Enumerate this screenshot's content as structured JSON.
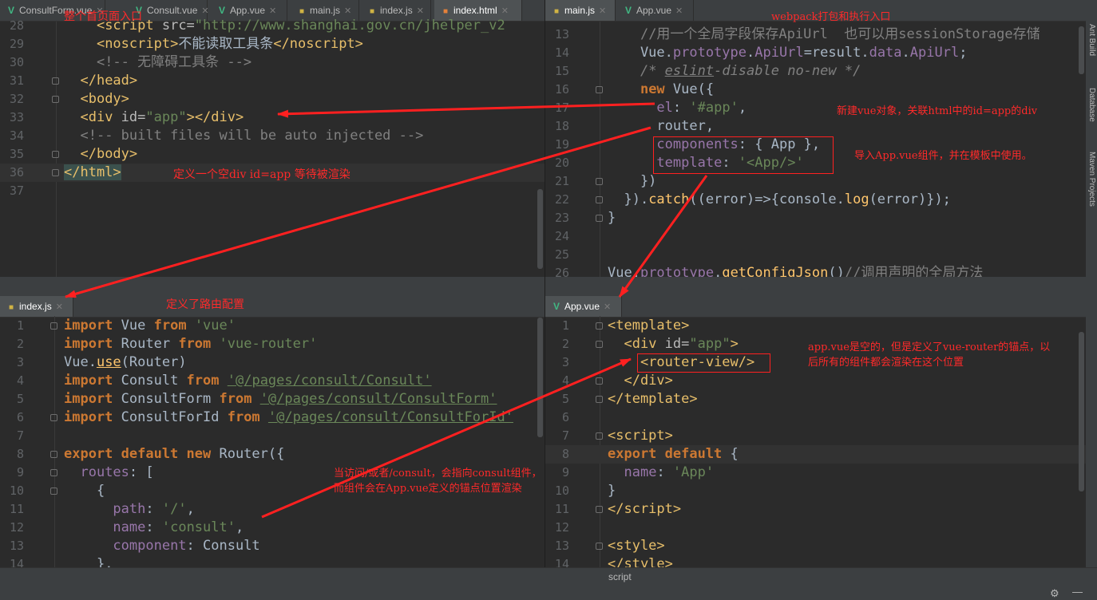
{
  "top_left": {
    "tabs": [
      "ConsultForm.vue",
      "Consult.vue",
      "App.vue",
      "main.js",
      "index.js",
      "index.html"
    ],
    "lines": [
      {
        "n": "28",
        "html": "    <span class=\"t\">&lt;script </span><span class=\"a\">src=</span><span class=\"s\">\"http://www.shanghai.gov.cn/jhelper_v2</span>"
      },
      {
        "n": "29",
        "html": "    <span class=\"t\">&lt;noscript&gt;</span>不能读取工具条<span class=\"t\">&lt;/noscript&gt;</span>"
      },
      {
        "n": "30",
        "html": "    <span class=\"c\">&lt;!-- 无障碍工具条 --&gt;</span>"
      },
      {
        "n": "31",
        "html": "  <span class=\"t\">&lt;/head&gt;</span>"
      },
      {
        "n": "32",
        "html": "  <span class=\"t\">&lt;body&gt;</span>"
      },
      {
        "n": "33",
        "html": "  <span class=\"t\">&lt;div </span><span class=\"a\">id=</span><span class=\"s\">\"app\"</span><span class=\"t\">&gt;&lt;/div&gt;</span>"
      },
      {
        "n": "34",
        "html": "  <span class=\"c\">&lt;!-- built files will be auto injected --&gt;</span>"
      },
      {
        "n": "35",
        "html": "  <span class=\"t\">&lt;/body&gt;</span>"
      },
      {
        "n": "36",
        "html": "<span class=\"t hl\">&lt;/html&gt;</span>"
      },
      {
        "n": "37",
        "html": ""
      }
    ]
  },
  "top_right": {
    "tabs": [
      "main.js",
      "App.vue"
    ],
    "lines": [
      {
        "n": "13",
        "html": "    <span class=\"c\">//用一个全局字段保存ApiUrl  也可以用sessionStorage存储</span>"
      },
      {
        "n": "14",
        "html": "    Vue.<span class=\"p\">prototype</span>.<span class=\"p\">ApiUrl</span>=result.<span class=\"p\">data</span>.<span class=\"p\">ApiUrl</span>;"
      },
      {
        "n": "15",
        "html": "    <span class=\"ci\">/* <span style=\"text-decoration:underline\">eslint</span>-disable no-new */</span>"
      },
      {
        "n": "16",
        "html": "    <span class=\"k\">new</span> Vue({"
      },
      {
        "n": "17",
        "html": "      <span class=\"p\">el</span>: <span class=\"s\">'#app'</span>,"
      },
      {
        "n": "18",
        "html": "      router,"
      },
      {
        "n": "19",
        "html": "      <span class=\"p\">components</span>: { App },"
      },
      {
        "n": "20",
        "html": "      <span class=\"p\">template</span>: <span class=\"s\">'&lt;App/&gt;'</span>"
      },
      {
        "n": "21",
        "html": "    })"
      },
      {
        "n": "22",
        "html": "  }).<span class=\"f\">catch</span>((error)=>{console.<span class=\"f\">log</span>(error)});"
      },
      {
        "n": "23",
        "html": "}"
      },
      {
        "n": "24",
        "html": ""
      },
      {
        "n": "25",
        "html": ""
      },
      {
        "n": "26",
        "html": "Vue.<span class=\"p\">prototype</span>.<span class=\"f\">getConfigJson</span>()<span class=\"c\">//调用声明的全局方法</span>"
      }
    ]
  },
  "bottom_left": {
    "tabs": [
      "index.js"
    ],
    "lines": [
      {
        "n": "1",
        "html": "<span class=\"k\">import</span> Vue <span class=\"k\">from</span> <span class=\"s\">'vue'</span>"
      },
      {
        "n": "2",
        "html": "<span class=\"k\">import</span> Router <span class=\"k\">from</span> <span class=\"s\">'vue-router'</span>"
      },
      {
        "n": "3",
        "html": "Vue.<span class=\"f\" style=\"text-decoration:underline\">use</span>(Router)"
      },
      {
        "n": "4",
        "html": "<span class=\"k\">import</span> Consult <span class=\"k\">from</span> <span class=\"s u\">'@/pages/consult/Consult'</span>"
      },
      {
        "n": "5",
        "html": "<span class=\"k\">import</span> ConsultForm <span class=\"k\">from</span> <span class=\"s u\">'@/pages/consult/ConsultForm'</span>"
      },
      {
        "n": "6",
        "html": "<span class=\"k\">import</span> ConsultForId <span class=\"k\">from</span> <span class=\"s u\">'@/pages/consult/ConsultForId'</span>"
      },
      {
        "n": "7",
        "html": ""
      },
      {
        "n": "8",
        "html": "<span class=\"k\">export default new</span> Router({"
      },
      {
        "n": "9",
        "html": "  <span class=\"p\">routes</span>: ["
      },
      {
        "n": "10",
        "html": "    {"
      },
      {
        "n": "11",
        "html": "      <span class=\"p\">path</span>: <span class=\"s\">'/'</span>,"
      },
      {
        "n": "12",
        "html": "      <span class=\"p\">name</span>: <span class=\"s\">'consult'</span>,"
      },
      {
        "n": "13",
        "html": "      <span class=\"p\">component</span>: Consult"
      },
      {
        "n": "14",
        "html": "    },"
      }
    ]
  },
  "bottom_right": {
    "tabs": [
      "App.vue"
    ],
    "lines": [
      {
        "n": "1",
        "html": "<span class=\"t\">&lt;template&gt;</span>"
      },
      {
        "n": "2",
        "html": "  <span class=\"t\">&lt;div </span><span class=\"a\">id=</span><span class=\"s\">\"app\"</span><span class=\"t\">&gt;</span>"
      },
      {
        "n": "3",
        "html": "    <span class=\"t\">&lt;router-view/&gt;</span>"
      },
      {
        "n": "4",
        "html": "  <span class=\"t\">&lt;/div&gt;</span>"
      },
      {
        "n": "5",
        "html": "<span class=\"t\">&lt;/template&gt;</span>"
      },
      {
        "n": "6",
        "html": ""
      },
      {
        "n": "7",
        "html": "<span class=\"t\">&lt;script&gt;</span>"
      },
      {
        "n": "8",
        "html": "<span class=\"k\">export default</span> {"
      },
      {
        "n": "9",
        "html": "  <span class=\"p\">name</span>: <span class=\"s\">'App'</span>"
      },
      {
        "n": "10",
        "html": "}"
      },
      {
        "n": "11",
        "html": "<span class=\"t\">&lt;/script&gt;</span>"
      },
      {
        "n": "12",
        "html": ""
      },
      {
        "n": "13",
        "html": "<span class=\"t\">&lt;style&gt;</span>"
      },
      {
        "n": "14",
        "html": "<span class=\"t\">&lt;/style&gt;</span>"
      }
    ]
  },
  "annotations": {
    "entry_page": "整个首页面入口",
    "webpack_entry": "webpack打包和执行入口",
    "empty_div": "定义一个空div id=app 等待被渲染",
    "new_vue": "新建vue对象，关联html中的id=app的div",
    "import_app": "导入App.vue组件，并在模板中使用。",
    "router_config": "定义了路由配置",
    "app_vue_1": "app.vue是空的，但是定义了vue-router的锚点，以",
    "app_vue_2": "后所有的组件都会渲染在这个位置",
    "consult_1": "当访问/或者/consult，会指向consult组件，",
    "consult_2": "而组件会在App.vue定义的锚点位置渲染"
  },
  "right_toolbar": [
    "Ant Build",
    "Database",
    "Maven Projects"
  ],
  "status": {
    "breadcrumb": "script"
  },
  "colors": {
    "annotation": "#ff2020",
    "editor_bg": "#2b2b2b",
    "keyword": "#cc7832",
    "string": "#6a8759",
    "tag": "#e8bf6a"
  }
}
